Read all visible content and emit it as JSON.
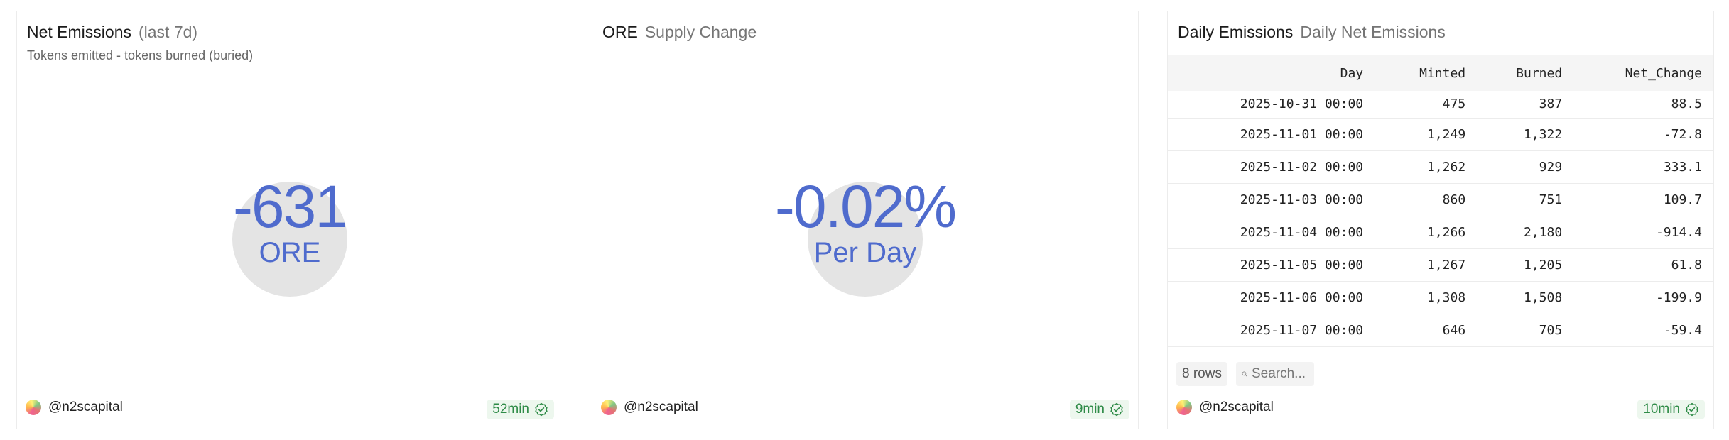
{
  "cards": [
    {
      "title": "Net Emissions",
      "subtitle": "(last 7d)",
      "description": "Tokens emitted - tokens burned (buried)",
      "value": "-631",
      "unit": "ORE",
      "author": "@n2scapital",
      "age": "52min"
    },
    {
      "title": "ORE",
      "subtitle": "Supply Change",
      "value": "-0.02%",
      "unit": "Per Day",
      "author": "@n2scapital",
      "age": "9min"
    },
    {
      "title": "Daily Emissions",
      "subtitle": "Daily Net Emissions",
      "columns": [
        "Day",
        "Minted",
        "Burned",
        "Net_Change"
      ],
      "rows": [
        [
          "2025-10-31 00:00",
          "475",
          "387",
          "88.5"
        ],
        [
          "2025-11-01 00:00",
          "1,249",
          "1,322",
          "-72.8"
        ],
        [
          "2025-11-02 00:00",
          "1,262",
          "929",
          "333.1"
        ],
        [
          "2025-11-03 00:00",
          "860",
          "751",
          "109.7"
        ],
        [
          "2025-11-04 00:00",
          "1,266",
          "2,180",
          "-914.4"
        ],
        [
          "2025-11-05 00:00",
          "1,267",
          "1,205",
          "61.8"
        ],
        [
          "2025-11-06 00:00",
          "1,308",
          "1,508",
          "-199.9"
        ],
        [
          "2025-11-07 00:00",
          "646",
          "705",
          "-59.4"
        ]
      ],
      "row_count": "8 rows",
      "search_placeholder": "Search...",
      "author": "@n2scapital",
      "age": "10min"
    }
  ],
  "colors": {
    "accent": "#4f6bcd",
    "badge_green": "#2e8b47",
    "badge_bg": "#edf7ee"
  }
}
